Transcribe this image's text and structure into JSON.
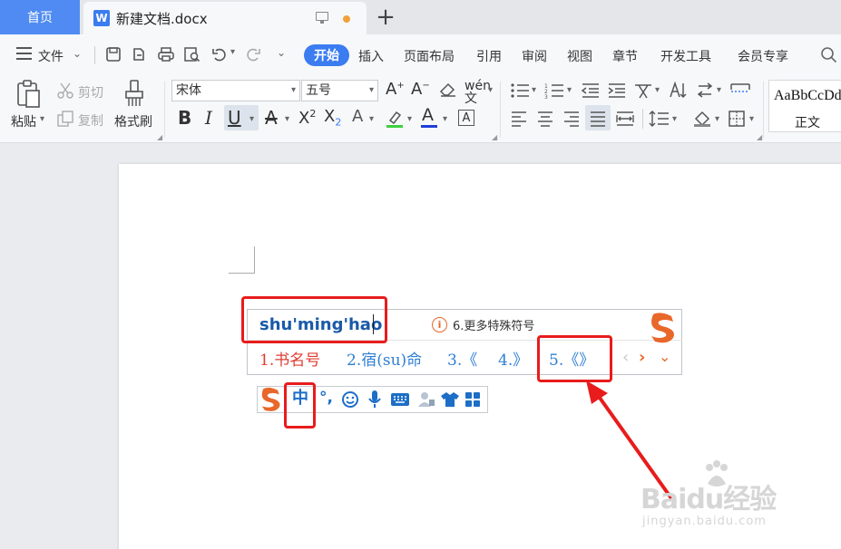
{
  "tabs": {
    "home_label": "首页",
    "document_label": "新建文档.docx",
    "doc_icon_letter": "W",
    "new_tab_symbol": "+"
  },
  "menu": {
    "file_label": "文件",
    "items": [
      "开始",
      "插入",
      "页面布局",
      "引用",
      "审阅",
      "视图",
      "章节",
      "开发工具",
      "会员专享"
    ]
  },
  "ribbon": {
    "paste_label": "粘贴",
    "cut_label": "剪切",
    "copy_label": "复制",
    "format_painter_label": "格式刷",
    "font_name": "宋体",
    "font_size": "五号",
    "style_preview_text": "AaBbCcDd",
    "style_name": "正文"
  },
  "ime": {
    "pinyin_input": "shu'ming'hao",
    "more_symbols_hint": "6.更多特殊符号",
    "candidates": [
      {
        "index": "1.",
        "text": "书名号"
      },
      {
        "index": "2.",
        "text": "宿(su)命"
      },
      {
        "index": "3.",
        "text": "《"
      },
      {
        "index": "4.",
        "text": "》"
      },
      {
        "index": "5.",
        "text": "《》"
      }
    ],
    "mode_label": "中",
    "punct_label": "°,"
  },
  "watermark": {
    "brand_text": "Baidu经验",
    "url_text": "jingyan.baidu.com"
  },
  "colors": {
    "accent_blue": "#3b7cf0",
    "annotation_red": "#e81c1c",
    "candidate_blue": "#2f7fd3",
    "sogou_orange": "#e8672a"
  }
}
